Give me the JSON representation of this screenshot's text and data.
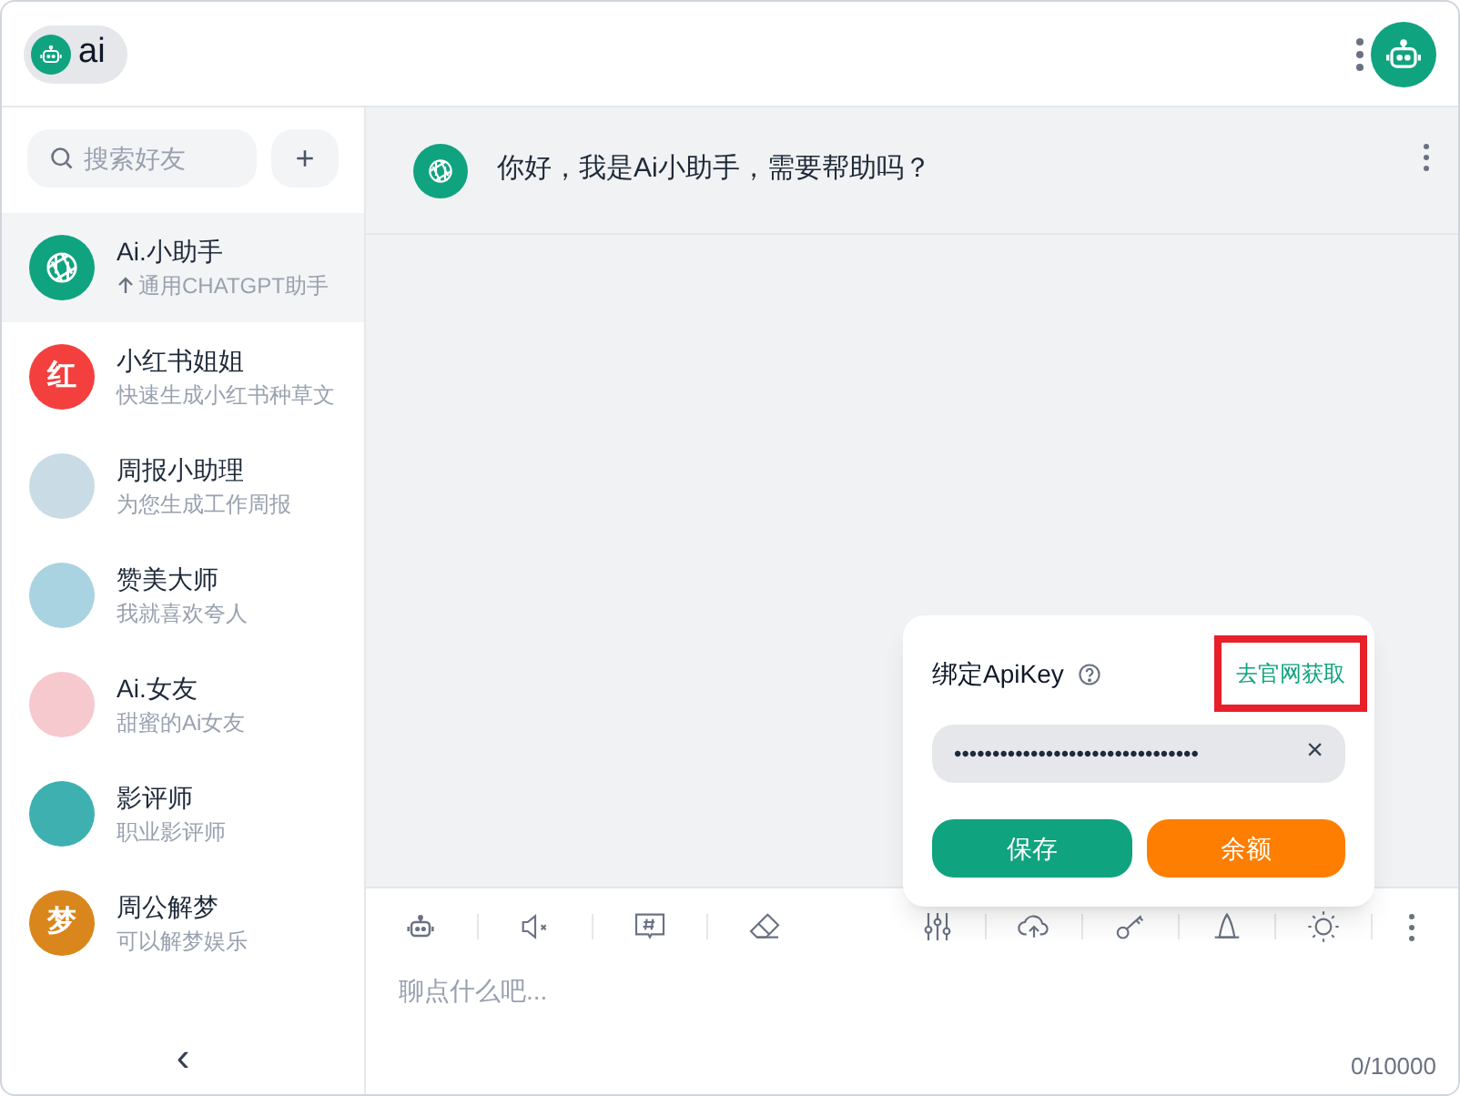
{
  "header": {
    "app_name": "ai"
  },
  "sidebar": {
    "search": {
      "placeholder": "搜索好友"
    },
    "add_button": "+",
    "collapse_button": "‹",
    "contacts": [
      {
        "name": "Ai.小助手",
        "subtitle": "通用CHATGPT助手",
        "pinned": true,
        "selected": true,
        "kind": "logo",
        "color": "#10a37f"
      },
      {
        "name": "小红书姐姐",
        "subtitle": "快速生成小红书种草文",
        "pinned": false,
        "selected": false,
        "kind": "letter",
        "avatar_text": "红",
        "color": "#f43f3f"
      },
      {
        "name": "周报小助理",
        "subtitle": "为您生成工作周报",
        "pinned": false,
        "selected": false,
        "kind": "picture",
        "color": "#c9dce6"
      },
      {
        "name": "赞美大师",
        "subtitle": "我就喜欢夸人",
        "pinned": false,
        "selected": false,
        "kind": "picture",
        "color": "#a9d3e0"
      },
      {
        "name": "Ai.女友",
        "subtitle": "甜蜜的Ai女友",
        "pinned": false,
        "selected": false,
        "kind": "picture",
        "color": "#f6c9cf"
      },
      {
        "name": "影评师",
        "subtitle": "职业影评师",
        "pinned": false,
        "selected": false,
        "kind": "picture",
        "color": "#3fb0b0"
      },
      {
        "name": "周公解梦",
        "subtitle": "可以解梦娱乐",
        "pinned": false,
        "selected": false,
        "kind": "letter",
        "avatar_text": "梦",
        "color": "#d9861c"
      }
    ]
  },
  "chat": {
    "greeting": "你好，我是Ai小助手，需要帮助吗？",
    "input": {
      "placeholder": "聊点什么吧...",
      "counter": "0/10000"
    }
  },
  "apikey_popup": {
    "title": "绑定ApiKey",
    "link": "去官网获取",
    "link_highlighted": true,
    "key_value": "••••••••••••••••••••••••••••••••",
    "clear_button": "×",
    "save_button": "保存",
    "balance_button": "余额"
  }
}
